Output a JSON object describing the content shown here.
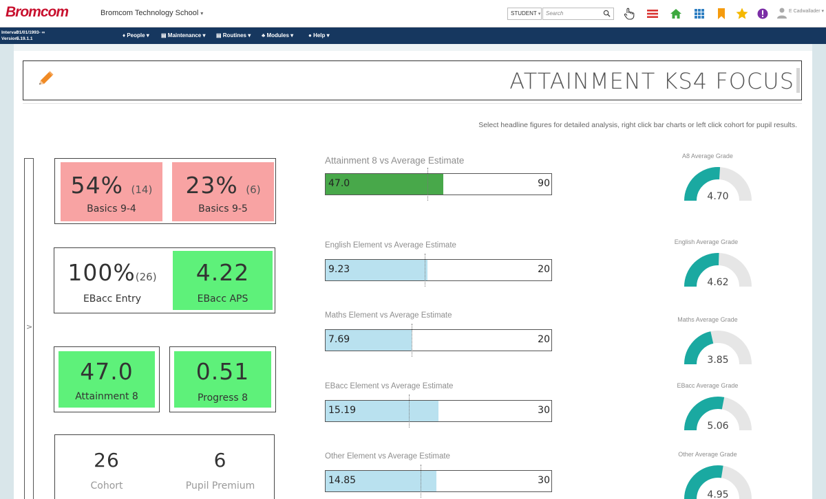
{
  "header": {
    "logo": "Bromcom",
    "school": "Bromcom Technology School",
    "role": "STUDENT",
    "search_placeholder": "Search",
    "user": "E Cadwallader",
    "colors": {
      "nav": "#16375f",
      "logo": "#c8102e"
    }
  },
  "nav": {
    "interval_label": "Interval:",
    "interval_value": "01/01/1993- ∞",
    "version_label": "Version:",
    "version_value": "5.19.1.1",
    "menus": [
      "People ▾",
      "Maintenance ▾",
      "Routines ▾",
      "Modules ▾",
      "Help ▾"
    ]
  },
  "page": {
    "title": "ATTAINMENT KS4 FOCUS",
    "hint": "Select headline figures for detailed analysis, right click bar charts or left click cohort for pupil results.",
    "side_toggle": ">"
  },
  "stats": {
    "basics94": {
      "value": "54%",
      "count": "(14)",
      "label": "Basics 9-4",
      "color": "#f8a3a3"
    },
    "basics95": {
      "value": "23%",
      "count": "(6)",
      "label": "Basics 9-5",
      "color": "#f8a3a3"
    },
    "ebacc_entry": {
      "value": "100%",
      "count": "(26)",
      "label": "EBacc Entry"
    },
    "ebacc_aps": {
      "value": "4.22",
      "label": "EBacc APS",
      "color": "#5ef17a"
    },
    "attainment8": {
      "value": "47.0",
      "label": "Attainment 8",
      "color": "#5ef17a"
    },
    "progress8": {
      "value": "0.51",
      "label": "Progress 8",
      "color": "#5ef17a"
    },
    "cohort": {
      "value": "26",
      "label": "Cohort"
    },
    "pupil_premium": {
      "value": "6",
      "label": "Pupil Premium"
    }
  },
  "bars": [
    {
      "title": "Attainment 8 vs Average Estimate",
      "value": "47.0",
      "max": "90",
      "fraction": 0.52,
      "estimate_fraction": 0.45,
      "color": "#48a84a"
    },
    {
      "title": "English Element vs Average Estimate",
      "value": "9.23",
      "max": "20",
      "fraction": 0.45,
      "estimate_fraction": 0.44,
      "color": "#b9e1ef"
    },
    {
      "title": "Maths Element vs Average Estimate",
      "value": "7.69",
      "max": "20",
      "fraction": 0.38,
      "estimate_fraction": 0.38,
      "color": "#b9e1ef"
    },
    {
      "title": "EBacc Element vs Average Estimate",
      "value": "15.19",
      "max": "30",
      "fraction": 0.5,
      "estimate_fraction": 0.37,
      "color": "#b9e1ef"
    },
    {
      "title": "Other Element vs Average Estimate",
      "value": "14.85",
      "max": "30",
      "fraction": 0.49,
      "estimate_fraction": 0.42,
      "color": "#b9e1ef"
    }
  ],
  "gauges": [
    {
      "title": "A8 Average Grade",
      "value": "4.70",
      "fraction": 0.52
    },
    {
      "title": "English Average Grade",
      "value": "4.62",
      "fraction": 0.51
    },
    {
      "title": "Maths Average Grade",
      "value": "3.85",
      "fraction": 0.43
    },
    {
      "title": "EBacc Average Grade",
      "value": "5.06",
      "fraction": 0.56
    },
    {
      "title": "Other Average Grade",
      "value": "4.95",
      "fraction": 0.55
    }
  ],
  "gauge_colors": {
    "fill": "#1aa9a1",
    "track": "#e6e6e6"
  }
}
